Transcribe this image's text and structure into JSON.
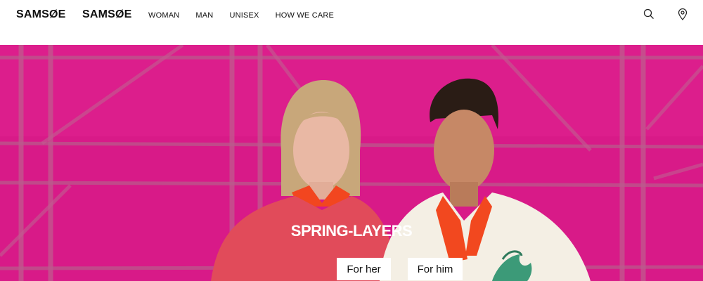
{
  "header": {
    "logo_primary": "SAMSØE",
    "logo_secondary": "SAMSØE",
    "nav": [
      {
        "label": "WOMAN"
      },
      {
        "label": "MAN"
      },
      {
        "label": "UNISEX"
      },
      {
        "label": "HOW WE CARE"
      }
    ],
    "icons": [
      "search-icon",
      "location-pin-icon"
    ]
  },
  "hero": {
    "title": "SPRING-LAYERS",
    "buttons": [
      {
        "label": "For her"
      },
      {
        "label": "For him"
      }
    ],
    "background_color": "#d81a86"
  }
}
